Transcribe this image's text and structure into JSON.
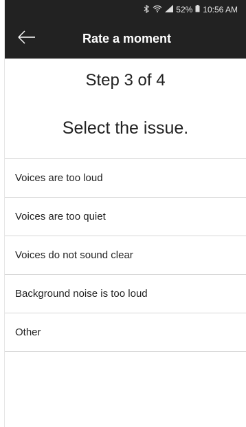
{
  "status_bar": {
    "battery": "52%",
    "time": "10:56 AM",
    "icons": [
      "bluetooth-icon",
      "wifi-icon",
      "signal-icon",
      "battery-icon"
    ]
  },
  "app_bar": {
    "title": "Rate a moment",
    "back_icon": "arrow-left-icon"
  },
  "step": {
    "label": "Step 3 of 4"
  },
  "prompt": {
    "text": "Select the issue."
  },
  "issues": [
    {
      "label": "Voices are too loud"
    },
    {
      "label": "Voices are too quiet"
    },
    {
      "label": "Voices do not sound clear"
    },
    {
      "label": "Background noise is too loud"
    },
    {
      "label": "Other"
    }
  ],
  "colors": {
    "header_background": "#222222",
    "divider": "#d6d6d6",
    "text": "#222222"
  }
}
